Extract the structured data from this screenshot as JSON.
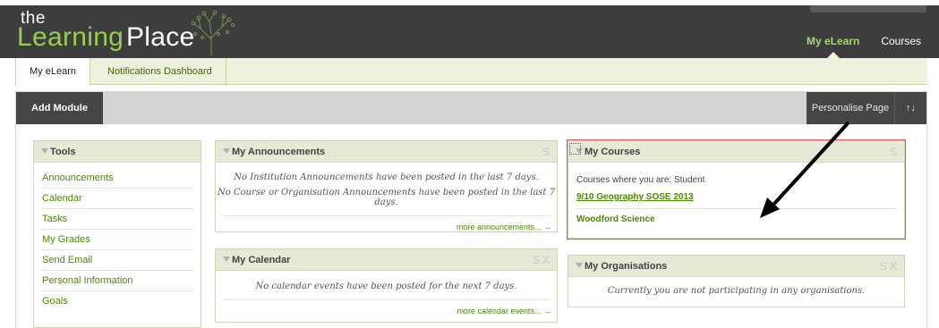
{
  "logo": {
    "the": "the",
    "learning": "Learning",
    "place": "Place"
  },
  "top_nav": [
    {
      "label": "My eLearn",
      "active": true
    },
    {
      "label": "Courses",
      "active": false
    }
  ],
  "subtabs": {
    "active": "My eLearn",
    "second": "Notifications Dashboard"
  },
  "toolbar": {
    "add_module": "Add Module",
    "personalise": "Personalise Page",
    "sort_icon": "↑↓"
  },
  "tools": {
    "title": "Tools",
    "items": [
      "Announcements",
      "Calendar",
      "Tasks",
      "My Grades",
      "Send Email",
      "Personal Information",
      "Goals"
    ]
  },
  "announcements": {
    "title": "My Announcements",
    "ctrl": "S",
    "line1": "No Institution Announcements have been posted in the last 7 days.",
    "line2": "No Course or Organisation Announcements have been posted in the last 7 days.",
    "more": "more announcements... →"
  },
  "calendar": {
    "title": "My Calendar",
    "ctrl": "S X",
    "text": "No calendar events have been posted for the next 7 days.",
    "more": "more calendar events... →"
  },
  "courses": {
    "title": "My Courses",
    "ctrl": "S",
    "label": "Courses where you are: Student",
    "items": [
      "9/10 Geography SOSE 2013",
      "Woodford Science"
    ]
  },
  "organisations": {
    "title": "My Organisations",
    "ctrl": "S X",
    "text": "Currently you are not participating in any organisations."
  },
  "colors": {
    "header": "#3d3d3d",
    "accent_green": "#4a8a00",
    "logo_green": "#9bcc4e",
    "highlight": "#e0555b"
  }
}
